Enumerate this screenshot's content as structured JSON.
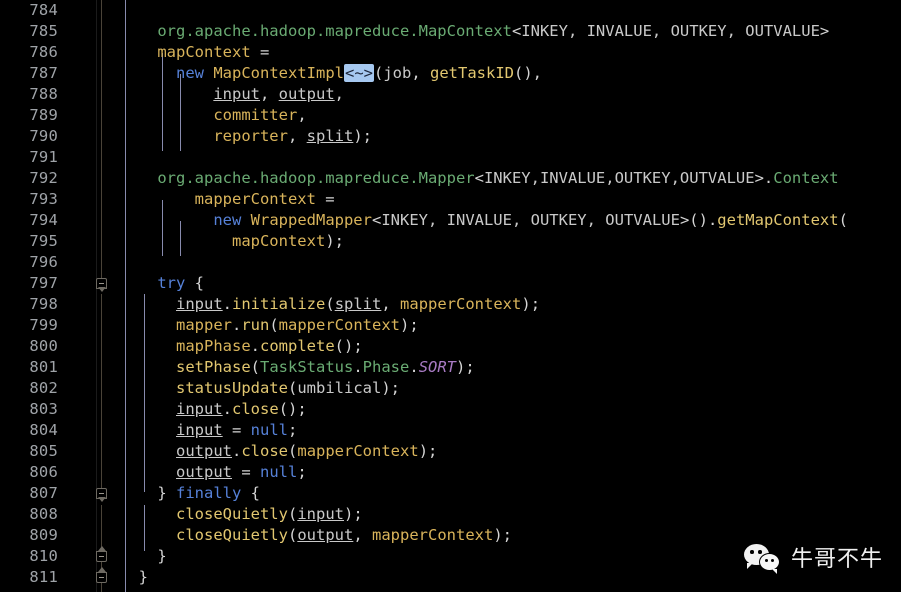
{
  "editor": {
    "theme_background": "#000000",
    "line_number_color": "#9fa3a8",
    "first_line": 784,
    "last_line": 811,
    "line_height": 21,
    "fold_placeholder": "<~>"
  },
  "lines": [
    {
      "num": "784",
      "text": ""
    },
    {
      "num": "785",
      "text": "    org.apache.hadoop.mapreduce.MapContext<INKEY, INVALUE, OUTKEY, OUTVALUE>"
    },
    {
      "num": "786",
      "text": "    mapContext ="
    },
    {
      "num": "787",
      "text": "      new MapContextImpl<~>(job, getTaskID(),"
    },
    {
      "num": "788",
      "text": "          input, output,"
    },
    {
      "num": "789",
      "text": "          committer,"
    },
    {
      "num": "790",
      "text": "          reporter, split);"
    },
    {
      "num": "791",
      "text": ""
    },
    {
      "num": "792",
      "text": "    org.apache.hadoop.mapreduce.Mapper<INKEY,INVALUE,OUTKEY,OUTVALUE>.Context"
    },
    {
      "num": "793",
      "text": "        mapperContext ="
    },
    {
      "num": "794",
      "text": "          new WrappedMapper<INKEY, INVALUE, OUTKEY, OUTVALUE>().getMapContext("
    },
    {
      "num": "795",
      "text": "            mapContext);"
    },
    {
      "num": "796",
      "text": ""
    },
    {
      "num": "797",
      "text": "    try {"
    },
    {
      "num": "798",
      "text": "      input.initialize(split, mapperContext);"
    },
    {
      "num": "799",
      "text": "      mapper.run(mapperContext);"
    },
    {
      "num": "800",
      "text": "      mapPhase.complete();"
    },
    {
      "num": "801",
      "text": "      setPhase(TaskStatus.Phase.SORT);"
    },
    {
      "num": "802",
      "text": "      statusUpdate(umbilical);"
    },
    {
      "num": "803",
      "text": "      input.close();"
    },
    {
      "num": "804",
      "text": "      input = null;"
    },
    {
      "num": "805",
      "text": "      output.close(mapperContext);"
    },
    {
      "num": "806",
      "text": "      output = null;"
    },
    {
      "num": "807",
      "text": "    } finally {"
    },
    {
      "num": "808",
      "text": "      closeQuietly(input);"
    },
    {
      "num": "809",
      "text": "      closeQuietly(output, mapperContext);"
    },
    {
      "num": "810",
      "text": "    }"
    },
    {
      "num": "811",
      "text": "  }"
    }
  ],
  "fold_markers": [
    {
      "line": "797",
      "type": "start"
    },
    {
      "line": "807",
      "type": "start"
    },
    {
      "line": "810",
      "type": "end"
    },
    {
      "line": "811",
      "type": "end"
    }
  ],
  "watermark": {
    "icon": "wechat-icon",
    "text": "牛哥不牛"
  },
  "colors": {
    "background": "#000000",
    "class_green": "#6aab73",
    "keyword_blue": "#5681d8",
    "type_gold": "#d9b45b",
    "method_yellow": "#e2c770",
    "identifier_gray": "#c9c9c9",
    "static_purple": "#a97bc4",
    "fold_highlight": "#a6c8f0",
    "indent_guide": "#b6b9e8"
  }
}
